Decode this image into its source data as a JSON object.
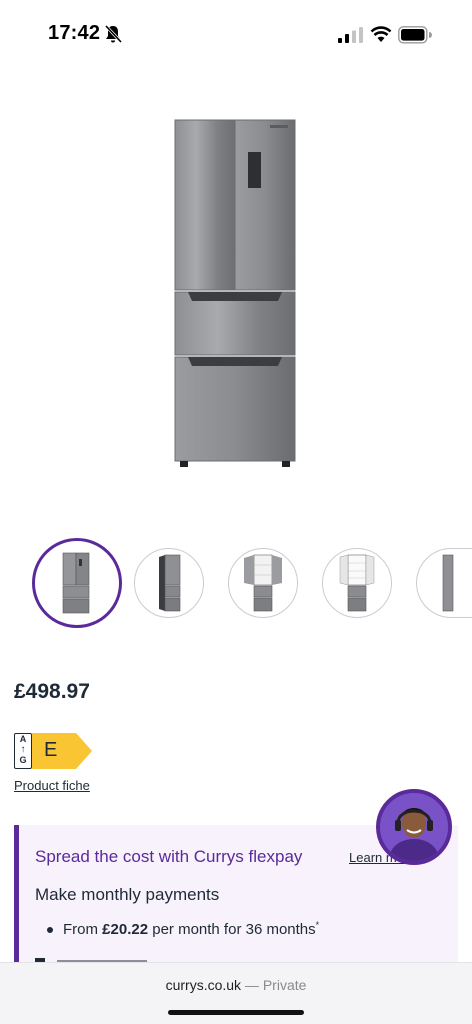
{
  "status_bar": {
    "time": "17:42",
    "icons": [
      "bell-off-icon",
      "cellular-signal-icon",
      "wifi-icon",
      "battery-icon"
    ]
  },
  "product": {
    "image_alt": "French door fridge freezer, stainless steel",
    "thumbnails": [
      {
        "name": "front-view",
        "selected": true
      },
      {
        "name": "angled-view",
        "selected": false
      },
      {
        "name": "doors-open-view",
        "selected": false
      },
      {
        "name": "interior-view",
        "selected": false
      },
      {
        "name": "side-view",
        "selected": false
      }
    ],
    "price": "£498.97",
    "energy": {
      "scale_top": "A",
      "scale_bottom": "G",
      "rating": "E",
      "color": "#f9c532"
    },
    "product_fiche": "Product fiche"
  },
  "flexpay": {
    "title": "Spread the cost with Currys flexpay",
    "learn_more": "Learn more",
    "subtitle": "Make monthly payments",
    "bullet_prefix": "From ",
    "bullet_amount": "£20.22",
    "bullet_suffix": " per month for 36 months",
    "bullet_mark": "*"
  },
  "browser": {
    "domain": "currys.co.uk",
    "separator": " — ",
    "mode": "Private"
  },
  "colors": {
    "brand_purple": "#5b2a9a",
    "card_bg": "#f7f2fb",
    "text": "#1f2a37"
  }
}
